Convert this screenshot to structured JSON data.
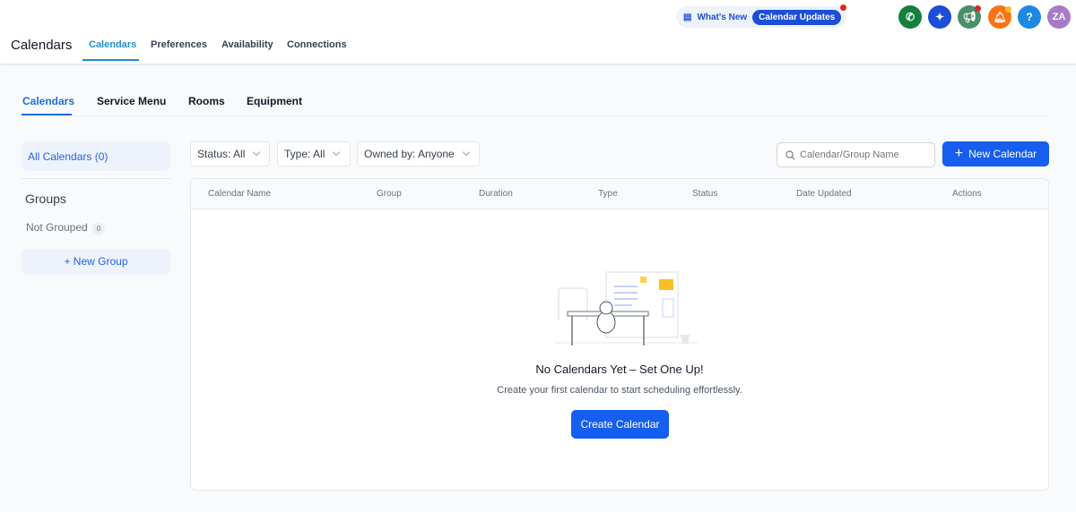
{
  "header": {
    "app_title": "Calendars",
    "tabs": [
      {
        "label": "Calendars"
      },
      {
        "label": "Preferences"
      },
      {
        "label": "Availability"
      },
      {
        "label": "Connections"
      }
    ],
    "whats_new": "What's New",
    "calendar_updates": "Calendar Updates",
    "avatar_initials": "ZA",
    "help": "?"
  },
  "subtabs": [
    {
      "label": "Calendars"
    },
    {
      "label": "Service Menu"
    },
    {
      "label": "Rooms"
    },
    {
      "label": "Equipment"
    }
  ],
  "sidebar": {
    "all_calendars": "All Calendars (0)",
    "groups_title": "Groups",
    "not_grouped": "Not Grouped",
    "not_grouped_count": "0",
    "new_group": "+ New Group"
  },
  "filters": {
    "status": "Status: All",
    "type": "Type: All",
    "owned_by": "Owned by: Anyone"
  },
  "search": {
    "placeholder": "Calendar/Group Name"
  },
  "new_calendar": "New Calendar",
  "table": {
    "columns": [
      "Calendar Name",
      "Group",
      "Duration",
      "Type",
      "Status",
      "Date Updated",
      "Actions"
    ]
  },
  "empty": {
    "title": "No Calendars Yet – Set One Up!",
    "subtitle": "Create your first calendar to start scheduling effortlessly.",
    "button": "Create Calendar"
  },
  "colors": {
    "accent": "#155eef",
    "tab_active": "#1d8fcf"
  }
}
